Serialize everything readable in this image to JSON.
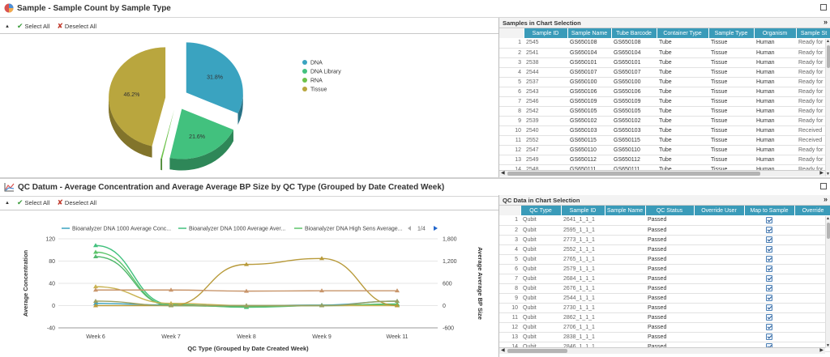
{
  "top_panel": {
    "title": "Sample - Sample Count by Sample Type",
    "select_all": "Select All",
    "deselect_all": "Deselect All"
  },
  "bottom_panel": {
    "title": "QC Datum - Average Concentration and Average Average BP Size by QC Type (Grouped by Date Created Week)",
    "select_all": "Select All",
    "deselect_all": "Deselect All"
  },
  "chart_data": [
    {
      "type": "pie",
      "legend_placement": "right",
      "categories": [
        "DNA",
        "DNA Library",
        "RNA",
        "Tissue"
      ],
      "values": [
        31.8,
        21.6,
        0.4,
        46.2
      ],
      "labels": [
        "31.8%",
        "21.6%",
        "",
        "46.2%"
      ],
      "colors": [
        "#3aa3c0",
        "#42c17e",
        "#6cc24a",
        "#b9a63e"
      ]
    },
    {
      "type": "line",
      "categories": [
        "Week 6",
        "Week 7",
        "Week 8",
        "Week 9",
        "Week 11"
      ],
      "xlabel": "QC Type (Grouped by Date Created Week)",
      "ylabel": "Average Concentration",
      "y2label": "Average Average BP Size",
      "ylim": [
        -40,
        120
      ],
      "y2lim": [
        -600,
        1800
      ],
      "yticks": [
        "120",
        "80",
        "40",
        "0",
        "-40"
      ],
      "y2ticks": [
        "1,800",
        "1,200",
        "600",
        "0",
        "-600"
      ],
      "legend_placement": "top",
      "legend_items": [
        "Bioanalyzer DNA 1000 Average Conc...",
        "Bioanalyzer DNA 1000 Average Aver...",
        "Bioanalyzer DNA High Sens Average..."
      ],
      "legend_page": "1/4",
      "series": [
        {
          "color": "#3aa3c0",
          "axis": "left",
          "values": [
            4,
            1,
            0,
            1,
            8
          ]
        },
        {
          "color": "#42c17e",
          "axis": "left",
          "values": [
            108,
            2,
            -3,
            0,
            3
          ]
        },
        {
          "color": "#5cc46a",
          "axis": "left",
          "values": [
            96,
            0,
            -2,
            0,
            2
          ]
        },
        {
          "color": "#52b86e",
          "axis": "left",
          "values": [
            88,
            0,
            -1,
            0,
            1
          ]
        },
        {
          "color": "#c9b352",
          "axis": "left",
          "values": [
            34,
            4,
            0,
            0,
            0
          ]
        },
        {
          "color": "#b89a3a",
          "axis": "right",
          "values": [
            0,
            0,
            1110,
            1270,
            0
          ]
        },
        {
          "color": "#c8956b",
          "axis": "right",
          "values": [
            420,
            420,
            390,
            400,
            400
          ]
        },
        {
          "color": "#9aa060",
          "axis": "right",
          "values": [
            120,
            0,
            0,
            0,
            120
          ]
        }
      ]
    }
  ],
  "samples_table": {
    "title": "Samples in Chart Selection",
    "columns": [
      "",
      "Sample ID",
      "Sample Name",
      "Tube Barcode",
      "Container Type",
      "Sample Type",
      "Organism",
      "Sample St"
    ],
    "rows": [
      [
        "1",
        "2545",
        "GS650108",
        "GS650108",
        "Tube",
        "Tissue",
        "Human",
        "Ready for"
      ],
      [
        "2",
        "2541",
        "GS650104",
        "GS650104",
        "Tube",
        "Tissue",
        "Human",
        "Ready for"
      ],
      [
        "3",
        "2538",
        "GS650101",
        "GS650101",
        "Tube",
        "Tissue",
        "Human",
        "Ready for"
      ],
      [
        "4",
        "2544",
        "GS650107",
        "GS650107",
        "Tube",
        "Tissue",
        "Human",
        "Ready for"
      ],
      [
        "5",
        "2537",
        "GS650100",
        "GS650100",
        "Tube",
        "Tissue",
        "Human",
        "Ready for"
      ],
      [
        "6",
        "2543",
        "GS650106",
        "GS650106",
        "Tube",
        "Tissue",
        "Human",
        "Ready for"
      ],
      [
        "7",
        "2546",
        "GS650109",
        "GS650109",
        "Tube",
        "Tissue",
        "Human",
        "Ready for"
      ],
      [
        "8",
        "2542",
        "GS650105",
        "GS650105",
        "Tube",
        "Tissue",
        "Human",
        "Ready for"
      ],
      [
        "9",
        "2539",
        "GS650102",
        "GS650102",
        "Tube",
        "Tissue",
        "Human",
        "Ready for"
      ],
      [
        "10",
        "2540",
        "GS650103",
        "GS650103",
        "Tube",
        "Tissue",
        "Human",
        "Received"
      ],
      [
        "11",
        "2552",
        "GS650115",
        "GS650115",
        "Tube",
        "Tissue",
        "Human",
        "Received"
      ],
      [
        "12",
        "2547",
        "GS650110",
        "GS650110",
        "Tube",
        "Tissue",
        "Human",
        "Ready for"
      ],
      [
        "13",
        "2549",
        "GS650112",
        "GS650112",
        "Tube",
        "Tissue",
        "Human",
        "Ready for"
      ],
      [
        "14",
        "2548",
        "GS650111",
        "GS650111",
        "Tube",
        "Tissue",
        "Human",
        "Ready for"
      ]
    ]
  },
  "qc_table": {
    "title": "QC Data in Chart Selection",
    "columns": [
      "",
      "QC Type",
      "Sample ID",
      "Sample Name",
      "QC Status",
      "Override User",
      "Map to Sample",
      "Override"
    ],
    "rows": [
      [
        "1",
        "Qubit",
        "2641_1_1_1",
        "",
        "Passed",
        "",
        "checked",
        ""
      ],
      [
        "2",
        "Qubit",
        "2595_1_1_1",
        "",
        "Passed",
        "",
        "checked",
        ""
      ],
      [
        "3",
        "Qubit",
        "2773_1_1_1",
        "",
        "Passed",
        "",
        "checked",
        ""
      ],
      [
        "4",
        "Qubit",
        "2552_1_1_1",
        "",
        "Passed",
        "",
        "checked",
        ""
      ],
      [
        "5",
        "Qubit",
        "2765_1_1_1",
        "",
        "Passed",
        "",
        "checked",
        ""
      ],
      [
        "6",
        "Qubit",
        "2579_1_1_1",
        "",
        "Passed",
        "",
        "checked",
        ""
      ],
      [
        "7",
        "Qubit",
        "2684_1_1_1",
        "",
        "Passed",
        "",
        "checked",
        ""
      ],
      [
        "8",
        "Qubit",
        "2676_1_1_1",
        "",
        "Passed",
        "",
        "checked",
        ""
      ],
      [
        "9",
        "Qubit",
        "2544_1_1_1",
        "",
        "Passed",
        "",
        "checked",
        ""
      ],
      [
        "10",
        "Qubit",
        "2730_1_1_1",
        "",
        "Passed",
        "",
        "checked",
        ""
      ],
      [
        "11",
        "Qubit",
        "2862_1_1_1",
        "",
        "Passed",
        "",
        "checked",
        ""
      ],
      [
        "12",
        "Qubit",
        "2706_1_1_1",
        "",
        "Passed",
        "",
        "checked",
        ""
      ],
      [
        "13",
        "Qubit",
        "2838_1_1_1",
        "",
        "Passed",
        "",
        "checked",
        ""
      ],
      [
        "14",
        "Qubit",
        "2846_1_1_1",
        "",
        "Passed",
        "",
        "checked",
        ""
      ]
    ]
  },
  "icons": {
    "pie_chart": "pie-chart-icon",
    "line_chart": "line-chart-icon",
    "expand": "double-chevron-icon",
    "select_check": "check-icon",
    "deselect": "deselect-icon"
  }
}
